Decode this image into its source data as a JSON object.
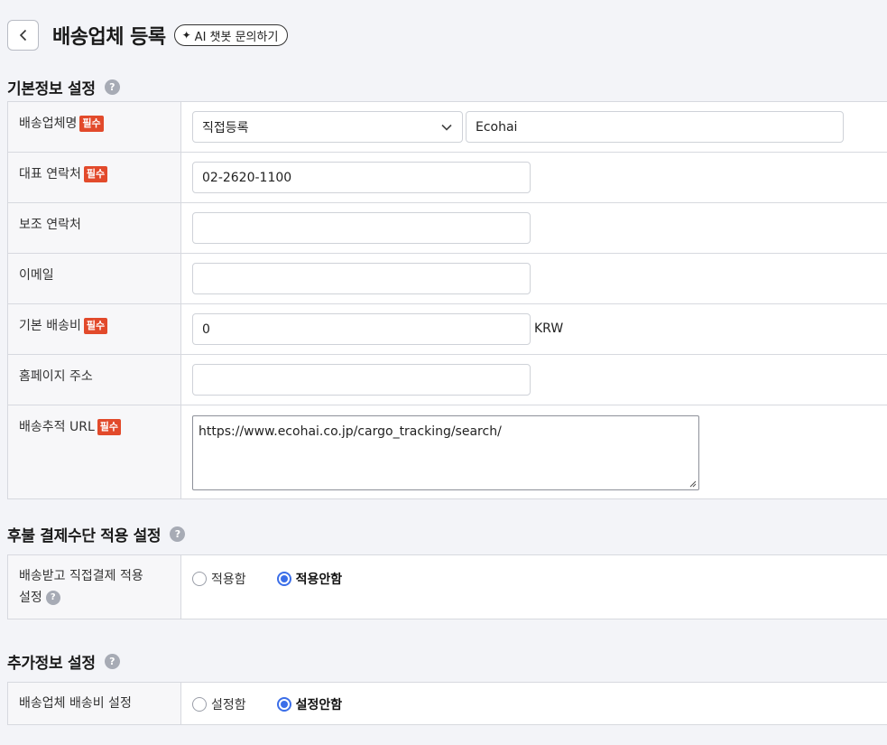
{
  "header": {
    "title": "배송업체 등록",
    "ai_chip": "AI 챗봇 문의하기"
  },
  "required_badge": "필수",
  "sections": {
    "basic": {
      "title": "기본정보 설정",
      "rows": {
        "carrier_name": {
          "label": "배송업체명",
          "select_value": "직접등록",
          "input_value": "Ecohai"
        },
        "main_contact": {
          "label": "대표 연락처",
          "value": "02-2620-1100"
        },
        "sub_contact": {
          "label": "보조 연락처",
          "value": ""
        },
        "email": {
          "label": "이메일",
          "value": ""
        },
        "base_fee": {
          "label": "기본 배송비",
          "value": "0",
          "unit": "KRW"
        },
        "homepage": {
          "label": "홈페이지 주소",
          "value": ""
        },
        "tracking_url": {
          "label": "배송추적 URL",
          "value": "https://www.ecohai.co.jp/cargo_tracking/search/"
        }
      }
    },
    "deferred": {
      "title": "후불 결제수단 적용 설정",
      "row_label_line1": "배송받고 직접결제 적용",
      "row_label_line2": "설정",
      "options": [
        "적용함",
        "적용안함"
      ],
      "selected": "적용안함"
    },
    "extra": {
      "title": "추가정보 설정",
      "row_label": "배송업체 배송비 설정",
      "options": [
        "설정함",
        "설정안함"
      ],
      "selected": "설정안함"
    }
  },
  "icons": {
    "back": "chevron-left-icon",
    "help": "question-circle-icon",
    "sparkle": "sparkle-icon",
    "dropdown": "chevron-down-icon"
  },
  "colors": {
    "required_badge": "#e24a2b",
    "radio_selected": "#3b6ee8",
    "background": "#f3f4f8"
  }
}
